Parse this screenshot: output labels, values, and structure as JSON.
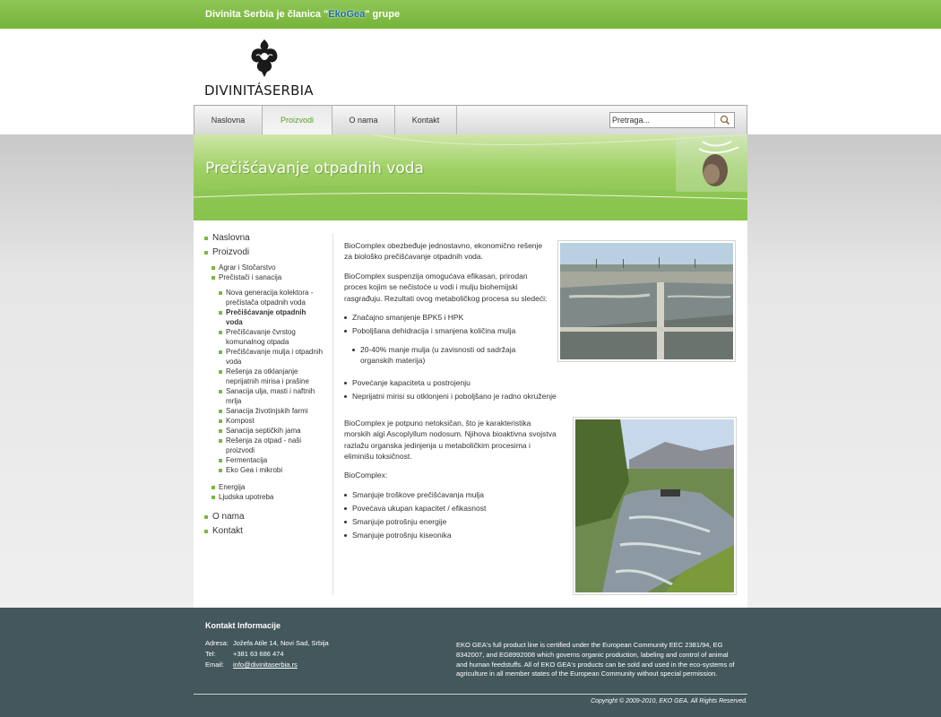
{
  "topbar": {
    "prefix": "Divinita Serbia je članica \"",
    "brand": "EkoGea",
    "suffix": "\" grupe"
  },
  "logo": {
    "name": "DIVINITÁSERBIA"
  },
  "nav": {
    "items": [
      {
        "label": "Naslovna"
      },
      {
        "label": "Proizvodi",
        "active": true
      },
      {
        "label": "O nama"
      },
      {
        "label": "Kontakt"
      }
    ],
    "search_placeholder": "Pretraga..."
  },
  "banner": {
    "title": "Prečišćavanje otpadnih voda"
  },
  "sidebar": {
    "top1": "Naslovna",
    "top2": "Proizvodi",
    "sub1": "Agrar i Stočarstvo",
    "sub2": "Prečistači i sanacija",
    "items": [
      "Nova generacija kolektora - prečistača otpadnih voda",
      "Prečišćavanje otpadnih voda",
      "Prečišćavanje čvrstog komunalnog otpada",
      "Prečišćavanje mulja i otpadnih voda",
      "Rešenja za otklanjanje neprijatnih mirisa i prašine",
      "Sanacija ulja, masti i naftnih mrlja",
      "Sanacija životinjskih farmi",
      "Kompost",
      "Sanacija septičkih jama",
      "Rešenja za otpad - naši proizvodi",
      "Fermentacija",
      "Eko Gea i mikrobi"
    ],
    "sub3": "Energija",
    "sub4": "Ljudska upotreba",
    "top3": "O nama",
    "top4": "Kontakt"
  },
  "main": {
    "p1": "BioComplex obezbeđuje jednostavno, ekonomično rešenje za biološko prečišćavanje otpadnih voda.",
    "p2": "BioComplex suspenzija omogućava efikasan, prirodan proces kojim se nečistoće u vodi i mulju biohemijski rasgrađuju. Rezultati ovog metaboličkog procesa su sledeći:",
    "list1": [
      "Značajno smanjenje BPK5 i HPK",
      "Poboljšana dehidracija i smanjena količina mulja"
    ],
    "sublist": "20-40% manje mulja (u zavisnosti od sadržaja organskih materija)",
    "list2": [
      "Povećanje kapaciteta u postrojenju",
      "Neprijatni mirisi su otklonjeni i poboljšano je radno okruženje"
    ],
    "p3": "BioComplex je potpuno netoksičan, što je karakteristika morskih algi Ascoplyllum nodosum. Njihova bioaktivna svojstva razlažu organska jedinjenja u metaboličkim procesima i eliminišu toksičnost.",
    "p4": "BioComplex:",
    "list3": [
      "Smanjuje troškove prečišćavanja mulja",
      "Povećava ukupan kapacitet / efikasnost",
      "Smanjuje potrošnju energije",
      "Smanjuje potrošnju kiseonika"
    ]
  },
  "footer": {
    "heading": "Kontakt Informacije",
    "address_label": "Adresa:",
    "address": "Jožefa Atile 14, Novi Sad, Srbija",
    "tel_label": "Tel:",
    "tel": "+381 63 686 474",
    "email_label": "Email:",
    "email": "info@divinitaserbia.rs",
    "cert": "EKO GEA's full product line is certified under the European Community EEC 2381/94, EG 8342007, and EG8992008 which governs organic production, labeling and control of animal and human feedstuffs. All of EKO GEA's products can be sold and used in the eco-systems of agriculture in all member states of the European Community without special permission.",
    "copyright": "Copyright © 2009-2010, EKO GEA. All Rights Reserved."
  }
}
